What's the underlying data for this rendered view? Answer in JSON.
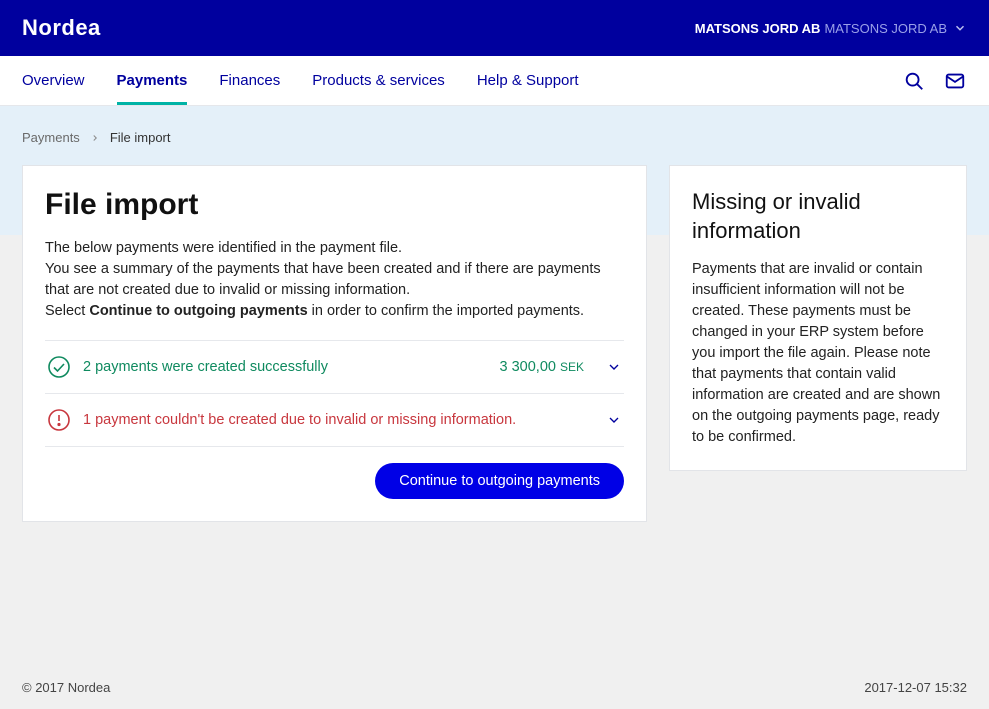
{
  "header": {
    "logo": "Nordea",
    "account_primary": "MATSONS JORD AB",
    "account_secondary": "MATSONS JORD AB"
  },
  "nav": {
    "items": [
      "Overview",
      "Payments",
      "Finances",
      "Products & services",
      "Help & Support"
    ],
    "active_index": 1
  },
  "breadcrumb": {
    "parent": "Payments",
    "current": "File import"
  },
  "main": {
    "title": "File import",
    "intro_line1": "The below payments were identified in the payment file.",
    "intro_line2": "You see a summary of the payments that have been created and if there are payments that are not created due to invalid or missing information.",
    "intro_line3_prefix": "Select ",
    "intro_line3_bold": "Continue to outgoing payments",
    "intro_line3_suffix": " in order to confirm the imported payments.",
    "status_success_text": "2 payments were created successfully",
    "status_success_amount": "3 300,00",
    "status_success_currency": "SEK",
    "status_error_text": "1 payment couldn't be created due to invalid or missing information.",
    "cta_label": "Continue to outgoing payments"
  },
  "side": {
    "title": "Missing or invalid information",
    "body": "Payments that are invalid or contain insufficient information will not be created. These payments must be changed in your ERP system before you import the file again. Please note that payments that contain valid information are created and are shown on the outgoing payments page, ready to be confirmed."
  },
  "footer": {
    "copyright": "© 2017 Nordea",
    "timestamp": "2017-12-07 15:32"
  }
}
